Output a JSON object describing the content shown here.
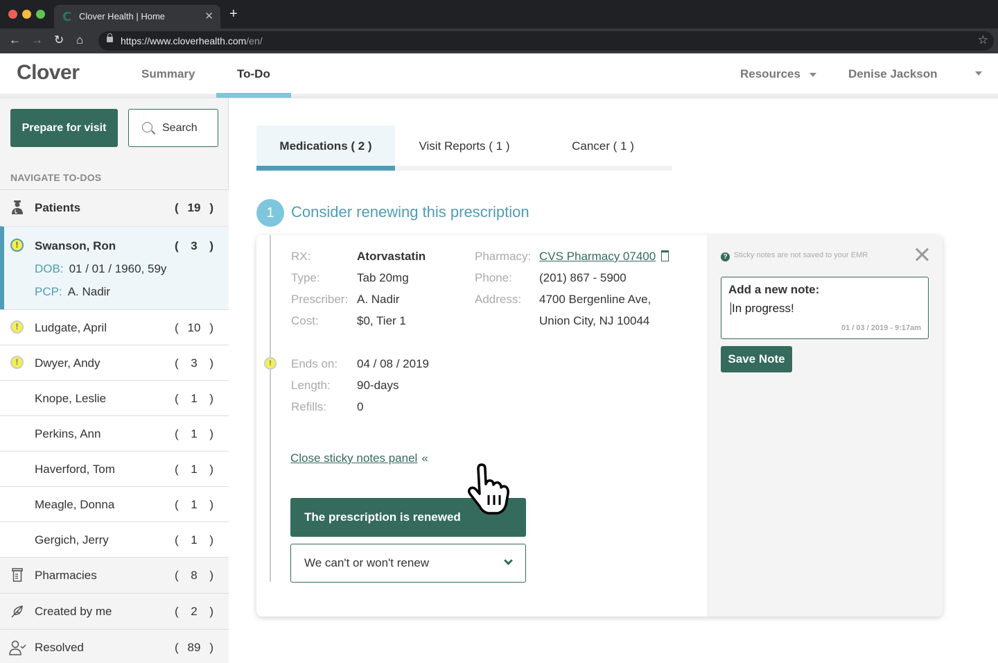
{
  "browser": {
    "tab_title": "Clover Health | Home",
    "tab_favicon": "C",
    "url_main": "https://www.cloverhealth.com",
    "url_path": "/en/",
    "icons": [
      "back-icon",
      "forward-icon",
      "reload-icon",
      "home-icon",
      "lock-icon",
      "bookmark-star-icon"
    ]
  },
  "header": {
    "logo": "Clover",
    "nav": [
      {
        "label": "Summary",
        "active": false
      },
      {
        "label": "To-Do",
        "active": true
      }
    ],
    "resources_label": "Resources",
    "user_name": "Denise Jackson"
  },
  "sidebar": {
    "prepare_label": "Prepare for visit",
    "search_label": "Search",
    "nav_heading": "NAVIGATE TO-DOS",
    "patients": {
      "label": "Patients",
      "count": "19"
    },
    "selected_patient": {
      "name": "Swanson, Ron",
      "count": "3",
      "dob_label": "DOB:",
      "dob": "01 / 01 / 1960, 59y",
      "pcp_label": "PCP:",
      "pcp": "A. Nadir"
    },
    "patient_list": [
      {
        "name": "Ludgate, April",
        "count": "10",
        "alert": true
      },
      {
        "name": "Dwyer, Andy",
        "count": "3",
        "alert": true
      },
      {
        "name": "Knope, Leslie",
        "count": "1",
        "alert": false
      },
      {
        "name": "Perkins, Ann",
        "count": "1",
        "alert": false
      },
      {
        "name": "Haverford, Tom",
        "count": "1",
        "alert": false
      },
      {
        "name": "Meagle, Donna",
        "count": "1",
        "alert": false
      },
      {
        "name": "Gergich, Jerry",
        "count": "1",
        "alert": false
      }
    ],
    "groups": [
      {
        "label": "Pharmacies",
        "count": "8",
        "icon": "pill-bottle-icon"
      },
      {
        "label": "Created by me",
        "count": "2",
        "icon": "feather-icon"
      },
      {
        "label": "Resolved",
        "count": "89",
        "icon": "user-check-icon"
      }
    ]
  },
  "main": {
    "tabs": [
      {
        "label": "Medications ( 2 )",
        "active": true
      },
      {
        "label": "Visit Reports ( 1 )",
        "active": false
      },
      {
        "label": "Cancer ( 1 )",
        "active": false
      }
    ],
    "step_number": "1",
    "step_title": "Consider renewing this prescription",
    "rx": {
      "rx_label": "RX:",
      "rx": "Atorvastatin",
      "type_label": "Type:",
      "type": "Tab 20mg",
      "prescriber_label": "Prescriber:",
      "prescriber": "A. Nadir",
      "cost_label": "Cost:",
      "cost": "$0, Tier 1",
      "pharmacy_label": "Pharmacy:",
      "pharmacy": "CVS Pharmacy 07400",
      "phone_label": "Phone:",
      "phone": "(201)  867 - 5900",
      "address_label": "Address:",
      "address_line1": "4700 Bergenline Ave,",
      "address_line2": "Union City, NJ  10044",
      "ends_label": "Ends on:",
      "ends": "04 / 08 / 2019",
      "length_label": "Length:",
      "length": "90-days",
      "refills_label": "Refills:",
      "refills": "0"
    },
    "close_panel_label": "Close sticky notes panel",
    "renewed_label": "The prescription is renewed",
    "wont_renew_label": "We can't or won't renew"
  },
  "sticky": {
    "info": "Sticky notes are not saved to your EMR",
    "note_label": "Add a new note:",
    "note_value": "In progress!",
    "note_timestamp": "01 / 03 / 2019  -  9:17am",
    "save_label": "Save Note"
  },
  "colors": {
    "brand_green": "#346b5c",
    "accent_blue": "#4e9db7",
    "light_blue": "#7ec6dc",
    "alert_yellow": "#f3f050"
  }
}
